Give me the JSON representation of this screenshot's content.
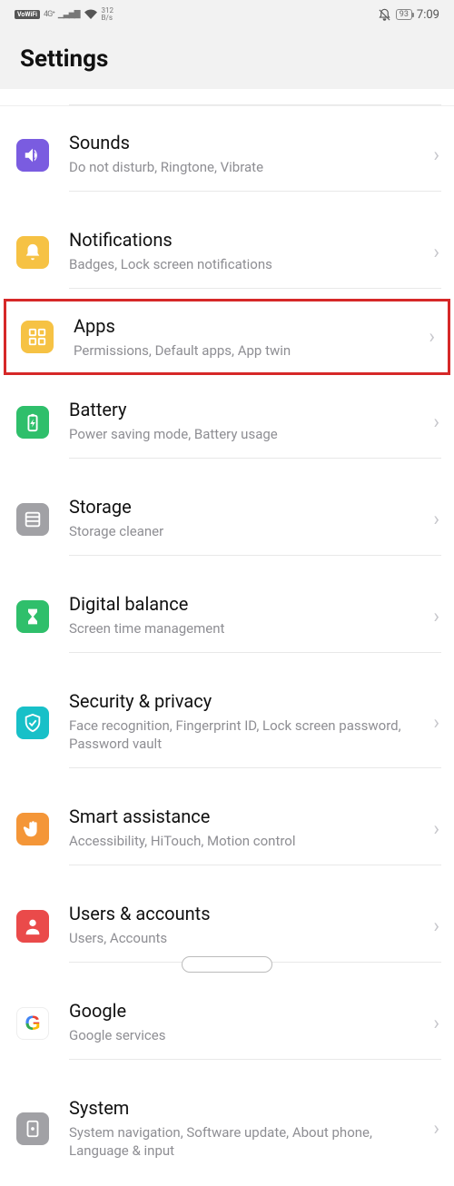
{
  "status": {
    "vowifi": "VoWiFi",
    "net": "4G⁺",
    "signal": "▁▃▅▇",
    "datarate_top": "312",
    "datarate_bot": "B/s",
    "battery": "93",
    "time": "7:09"
  },
  "header": {
    "title": "Settings"
  },
  "rows": {
    "sounds": {
      "title": "Sounds",
      "sub": "Do not disturb, Ringtone, Vibrate"
    },
    "notif": {
      "title": "Notifications",
      "sub": "Badges, Lock screen notifications"
    },
    "apps": {
      "title": "Apps",
      "sub": "Permissions, Default apps, App twin"
    },
    "battery": {
      "title": "Battery",
      "sub": "Power saving mode, Battery usage"
    },
    "storage": {
      "title": "Storage",
      "sub": "Storage cleaner"
    },
    "balance": {
      "title": "Digital balance",
      "sub": "Screen time management"
    },
    "security": {
      "title": "Security & privacy",
      "sub": "Face recognition, Fingerprint ID, Lock screen password, Password vault"
    },
    "smart": {
      "title": "Smart assistance",
      "sub": "Accessibility, HiTouch, Motion control"
    },
    "users": {
      "title": "Users & accounts",
      "sub": "Users, Accounts"
    },
    "google": {
      "title": "Google",
      "sub": "Google services"
    },
    "system": {
      "title": "System",
      "sub": "System navigation, Software update, About phone, Language & input"
    }
  }
}
